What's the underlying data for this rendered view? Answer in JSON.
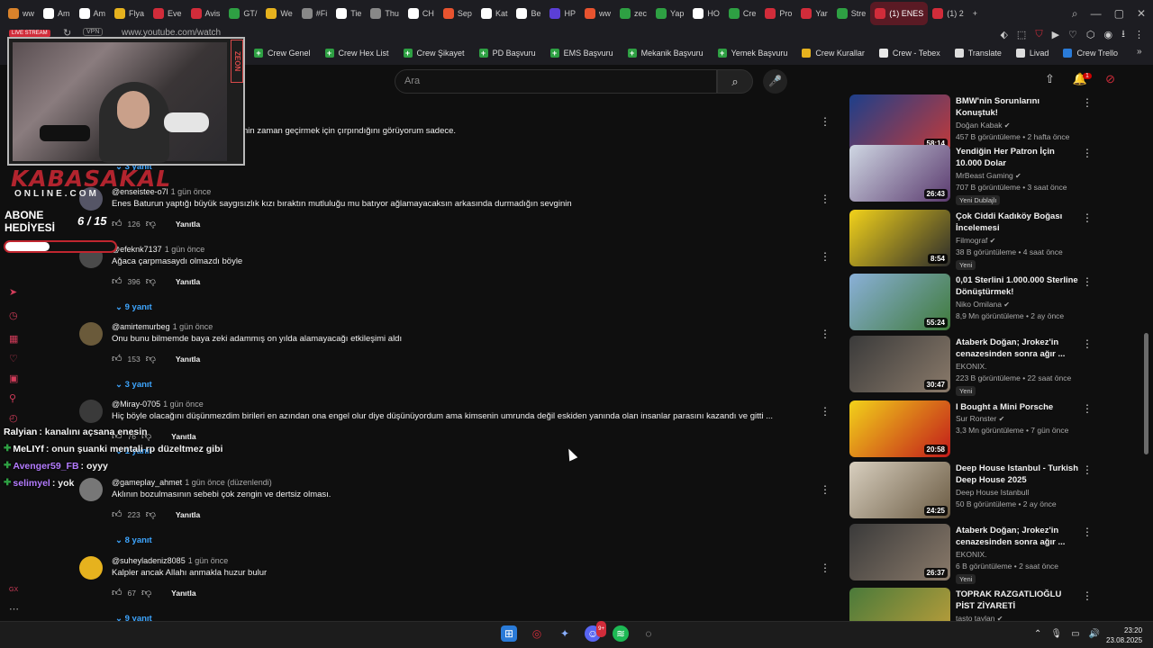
{
  "browser": {
    "tabs": [
      {
        "label": "ww",
        "color": "#d9822b"
      },
      {
        "label": "Am",
        "color": "#ffffff"
      },
      {
        "label": "Am",
        "color": "#ffffff"
      },
      {
        "label": "Flya",
        "color": "#e6b21e"
      },
      {
        "label": "Eve",
        "color": "#d12c3a"
      },
      {
        "label": "Avis",
        "color": "#d12c3a"
      },
      {
        "label": "GT/",
        "color": "#2ea043"
      },
      {
        "label": "We",
        "color": "#e6b21e"
      },
      {
        "label": "#Fi",
        "color": "#888888"
      },
      {
        "label": "Tie",
        "color": "#ffffff"
      },
      {
        "label": "Thu",
        "color": "#888888"
      },
      {
        "label": "CH",
        "color": "#ffffff"
      },
      {
        "label": "Sep",
        "color": "#e8532f"
      },
      {
        "label": "Kat",
        "color": "#ffffff"
      },
      {
        "label": "Be",
        "color": "#ffffff"
      },
      {
        "label": "HP",
        "color": "#5b3fd6"
      },
      {
        "label": "ww",
        "color": "#e8532f"
      },
      {
        "label": "zec",
        "color": "#2ea043"
      },
      {
        "label": "Yap",
        "color": "#2ea043"
      },
      {
        "label": "HO",
        "color": "#ffffff"
      },
      {
        "label": "Cre",
        "color": "#2ea043"
      },
      {
        "label": "Pro",
        "color": "#d12c3a"
      },
      {
        "label": "Yar",
        "color": "#d12c3a"
      },
      {
        "label": "Stre",
        "color": "#2ea043"
      },
      {
        "label": "(1) ENES",
        "color": "#d12c3a"
      },
      {
        "label": "(1) 2",
        "color": "#d12c3a"
      }
    ],
    "url": "www.youtube.com/watch",
    "vpn_label": "VPN",
    "bookmarks": [
      {
        "label": "Crew Genel",
        "icon": "plus"
      },
      {
        "label": "Crew Hex List",
        "icon": "plus"
      },
      {
        "label": "Crew Şikayet",
        "icon": "plus"
      },
      {
        "label": "PD Başvuru",
        "icon": "plus"
      },
      {
        "label": "EMS Başvuru",
        "icon": "plus"
      },
      {
        "label": "Mekanik Başvuru",
        "icon": "plus"
      },
      {
        "label": "Yemek Başvuru",
        "icon": "plus"
      },
      {
        "label": "Crew Kurallar",
        "icon": "folder"
      },
      {
        "label": "Crew - Tebex",
        "icon": "tebex"
      },
      {
        "label": "Translate",
        "icon": "translate"
      },
      {
        "label": "Livad",
        "icon": "livad"
      },
      {
        "label": "Crew Trello",
        "icon": "trello"
      }
    ]
  },
  "overlay": {
    "live_tag": "LIVE STREAM",
    "zeon": "ZEON",
    "brand": "KABASAKAL",
    "brand_sub": "ONLINE.COM",
    "abone_line1": "ABONE",
    "abone_line2": "HEDİYESİ",
    "counter": "6 / 15",
    "progress": 0.4,
    "chat": [
      {
        "user": "Ralyian",
        "message": ": kanalını açsana enesin",
        "color": "#ffffff",
        "badge": false
      },
      {
        "user": "MeLIYf",
        "message": ": onun şuanki mentali rp düzeltmez gibi",
        "color": "#ffffff",
        "badge": true
      },
      {
        "user": "Avenger59_FB",
        "message": ": oyyy",
        "color": "#b47cff",
        "badge": true
      },
      {
        "user": "selimyel",
        "message": ": yok",
        "color": "#b47cff",
        "badge": true
      }
    ]
  },
  "youtube": {
    "search_placeholder": "Ara",
    "notification_count": "1",
    "comments": [
      {
        "author": "",
        "time": "",
        "text": "nin zaman geçirmek için çırpındığını görüyorum sadece.",
        "likes": "",
        "reply_label": "",
        "replies": "3 yanıt"
      },
      {
        "author": "@enseistee-o7l",
        "time": "1 gün önce",
        "text": "Enes Baturun yaptığı büyük saygısızlık kızı bıraktın mutluluğu mu batıyor ağlamayacaksın arkasında durmadığın sevginin",
        "likes": "126",
        "reply_label": "Yanıtla",
        "replies": ""
      },
      {
        "author": "@efeknk7137",
        "time": "1 gün önce",
        "text": "Ağaca çarpmasaydı olmazdı böyle",
        "likes": "396",
        "reply_label": "Yanıtla",
        "replies": "9 yanıt"
      },
      {
        "author": "@amirtemurbeg",
        "time": "1 gün önce",
        "text": "Onu bunu bilmemde baya zeki adammış on yılda alamayacağı etkileşimi aldı",
        "likes": "153",
        "reply_label": "Yanıtla",
        "replies": "3 yanıt"
      },
      {
        "author": "@Miray-0705",
        "time": "1 gün önce",
        "text": "Hiç böyle olacağını düşünmezdim birileri en azından ona engel olur diye düşünüyordum ama kimsenin umrunda değil eskiden yanında olan insanlar parasını kazandı ve gitti ...",
        "likes": "76",
        "reply_label": "Yanıtla",
        "replies": "1 yanıt"
      },
      {
        "author": "@gameplay_ahmet",
        "time": "1 gün önce (düzenlendi)",
        "text": "Aklının bozulmasının sebebi çok zengin ve dertsiz olması.",
        "likes": "223",
        "reply_label": "Yanıtla",
        "replies": "8 yanıt"
      },
      {
        "author": "@suheyladeniz8085",
        "time": "1 gün önce",
        "text": "Kalpler ancak Allahı anmakla huzur bulur",
        "likes": "67",
        "reply_label": "Yanıtla",
        "replies": "9 yanıt"
      }
    ],
    "recommendations": [
      {
        "title": "BMW'nin Sorunlarını Konuştuk!",
        "channel": "Doğan Kabak",
        "verified": true,
        "meta": "457 B görüntüleme • 2 hafta önce",
        "duration": "58:14",
        "badge": "",
        "bg": "linear-gradient(135deg,#1d3f8a,#c23a3a)"
      },
      {
        "title": "Yendiğin Her Patron İçin 10.000 Dolar",
        "channel": "MrBeast Gaming",
        "verified": true,
        "meta": "707 B görüntüleme • 3 saat önce",
        "duration": "26:43",
        "badge": "Yeni  Dublajlı",
        "bg": "linear-gradient(135deg,#cfd7e3,#5a3a6e)"
      },
      {
        "title": "Çok Ciddi Kadıköy Boğası İncelemesi",
        "channel": "Filmograf",
        "verified": true,
        "meta": "38 B görüntüleme • 4 saat önce",
        "duration": "8:54",
        "badge": "Yeni",
        "bg": "linear-gradient(135deg,#f2d21a,#2b2b2b)"
      },
      {
        "title": "0,01 Sterlini 1.000.000 Sterline Dönüştürmek!",
        "channel": "Niko Omilana",
        "verified": true,
        "meta": "8,9 Mn görüntüleme • 2 ay önce",
        "duration": "55:24",
        "badge": "",
        "bg": "linear-gradient(135deg,#8ab0d8,#3f7a3a)"
      },
      {
        "title": "Ataberk Doğan; Jrokez'in cenazesinden sonra ağır ...",
        "channel": "EKONIX.",
        "verified": false,
        "meta": "223 B görüntüleme • 22 saat önce",
        "duration": "30:47",
        "badge": "Yeni",
        "bg": "linear-gradient(135deg,#3a3a3a,#8a7a6a)"
      },
      {
        "title": "I Bought a Mini Porsche",
        "channel": "Sur Ronster",
        "verified": true,
        "meta": "3,3 Mn görüntüleme • 7 gün önce",
        "duration": "20:58",
        "badge": "",
        "bg": "linear-gradient(135deg,#f2d21a,#c21a1a)"
      },
      {
        "title": "Deep House Istanbul - Turkish Deep House 2025",
        "channel": "Deep House Istanbull",
        "verified": false,
        "meta": "50 B görüntüleme • 2 ay önce",
        "duration": "24:25",
        "badge": "",
        "bg": "linear-gradient(135deg,#d8cfbf,#6a5a42)"
      },
      {
        "title": "Ataberk Doğan; Jrokez'in cenazesinden sonra ağır ...",
        "channel": "EKONIX.",
        "verified": false,
        "meta": "6 B görüntüleme • 2 saat önce",
        "duration": "26:37",
        "badge": "Yeni",
        "bg": "linear-gradient(135deg,#3a3a3a,#8a7a6a)"
      },
      {
        "title": "TOPRAK RAZGATLIOĞLU PİST ZİYARETİ",
        "channel": "tasto taylan",
        "verified": true,
        "meta": "",
        "duration": "",
        "badge": "",
        "bg": "linear-gradient(135deg,#4a7a3a,#c2a03a)"
      }
    ]
  },
  "taskbar": {
    "time": "23:20",
    "date": "23.08.2025",
    "discord_badge": "9+"
  }
}
